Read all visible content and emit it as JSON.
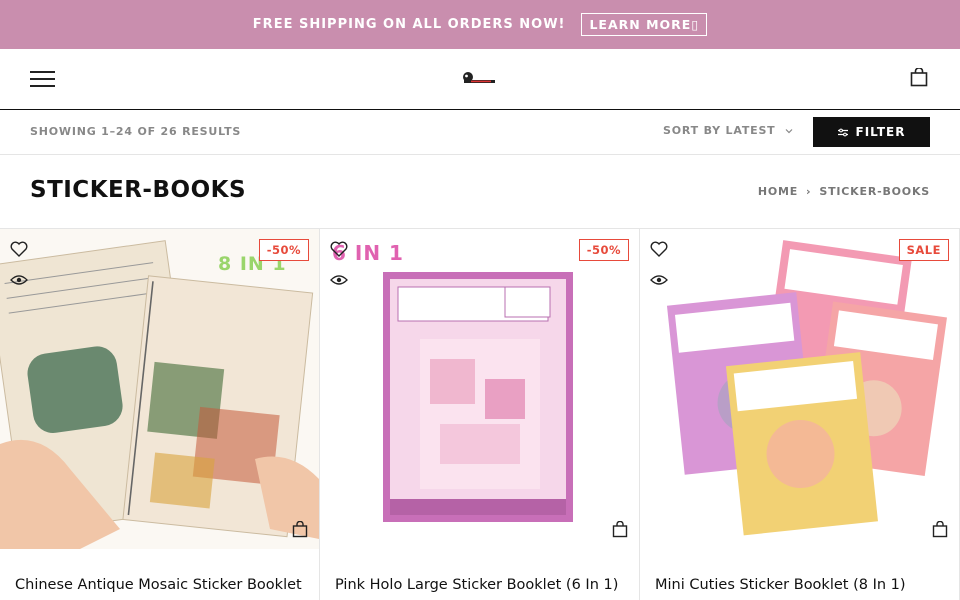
{
  "promo": {
    "text": "FREE SHIPPING ON ALL ORDERS NOW!",
    "button": "LEARN MORE▯"
  },
  "header": {
    "menu_icon": "hamburger-icon",
    "logo_alt": "store-logo",
    "cart_icon": "shopping-bag-icon"
  },
  "toolbar": {
    "results": "SHOWING 1–24 OF 26 RESULTS",
    "sort_label": "SORT BY LATEST",
    "filter_label": "FILTER"
  },
  "page": {
    "title": "STICKER-BOOKS"
  },
  "breadcrumb": {
    "home": "HOME",
    "current": "STICKER-BOOKS"
  },
  "colors": {
    "promo_bg": "#c98eae",
    "badge": "#e74a3b",
    "filter_bg": "#111111"
  },
  "products": [
    {
      "name": "Chinese Antique Mosaic Sticker Booklet",
      "badge": "-50%",
      "image_text": "8 IN 1"
    },
    {
      "name": "Pink Holo Large Sticker Booklet (6 In 1)",
      "badge": "-50%",
      "image_text": "6 IN 1"
    },
    {
      "name": "Mini Cuties Sticker Booklet (8 In 1)",
      "badge": "SALE",
      "image_text": ""
    }
  ]
}
